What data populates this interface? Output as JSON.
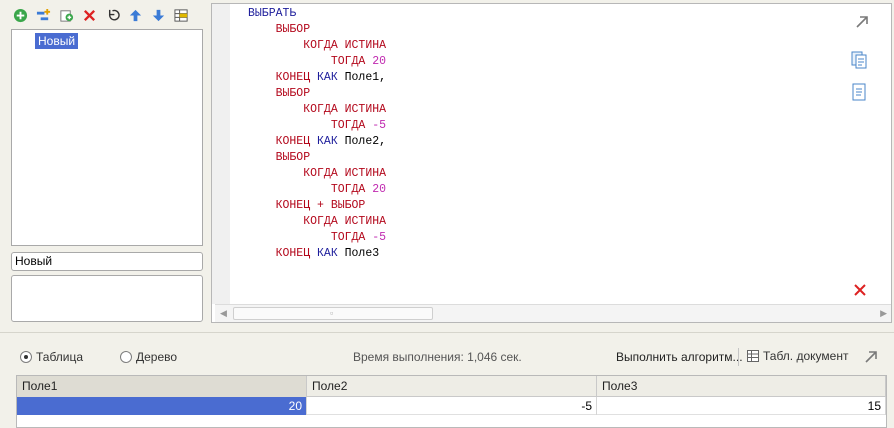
{
  "toolbar": {
    "buttons": [
      {
        "name": "add-icon",
        "color": "#2ea043"
      },
      {
        "name": "add-subquery-icon",
        "color": "#e0a000"
      },
      {
        "name": "copy-icon",
        "color": "#2ea043"
      },
      {
        "name": "delete-icon",
        "color": "#d22"
      },
      {
        "name": "refresh-icon",
        "color": "#333"
      },
      {
        "name": "move-up-icon",
        "color": "#3b7bd6"
      },
      {
        "name": "move-down-icon",
        "color": "#3b7bd6"
      },
      {
        "name": "grid-icon",
        "color": "#555"
      }
    ]
  },
  "queries": {
    "items": [
      "Новый"
    ],
    "name_value": "Новый"
  },
  "editor": {
    "lines": [
      [
        {
          "t": "ВЫБРАТЬ",
          "c": "blue"
        }
      ],
      [
        {
          "t": "    ВЫБОР",
          "c": "kw"
        }
      ],
      [
        {
          "t": "        КОГДА ИСТИНА",
          "c": "kw"
        }
      ],
      [
        {
          "t": "            ТОГДА ",
          "c": "kw"
        },
        {
          "t": "20",
          "c": "num"
        }
      ],
      [
        {
          "t": "    КОНЕЦ ",
          "c": "kw"
        },
        {
          "t": "КАК ",
          "c": "blue"
        },
        {
          "t": "Поле1,",
          "c": "ident"
        }
      ],
      [
        {
          "t": "    ВЫБОР",
          "c": "kw"
        }
      ],
      [
        {
          "t": "        КОГДА ИСТИНА",
          "c": "kw"
        }
      ],
      [
        {
          "t": "            ТОГДА ",
          "c": "kw"
        },
        {
          "t": "-5",
          "c": "num"
        }
      ],
      [
        {
          "t": "    КОНЕЦ ",
          "c": "kw"
        },
        {
          "t": "КАК ",
          "c": "blue"
        },
        {
          "t": "Поле2,",
          "c": "ident"
        }
      ],
      [
        {
          "t": "    ВЫБОР",
          "c": "kw"
        }
      ],
      [
        {
          "t": "        КОГДА ИСТИНА",
          "c": "kw"
        }
      ],
      [
        {
          "t": "            ТОГДА ",
          "c": "kw"
        },
        {
          "t": "20",
          "c": "num"
        }
      ],
      [
        {
          "t": "    КОНЕЦ ",
          "c": "kw"
        },
        {
          "t": "+ ",
          "c": "op"
        },
        {
          "t": "ВЫБОР",
          "c": "kw"
        }
      ],
      [
        {
          "t": "        КОГДА ИСТИНА",
          "c": "kw"
        }
      ],
      [
        {
          "t": "            ТОГДА ",
          "c": "kw"
        },
        {
          "t": "-5",
          "c": "num"
        }
      ],
      [
        {
          "t": "    КОНЕЦ ",
          "c": "kw"
        },
        {
          "t": "КАК ",
          "c": "blue"
        },
        {
          "t": "Поле3",
          "c": "ident"
        }
      ]
    ]
  },
  "results": {
    "view_table_label": "Таблица",
    "view_tree_label": "Дерево",
    "selected_view": "table",
    "exec_time": "Время выполнения: 1,046 сек.",
    "run_label": "Выполнить алгоритм...",
    "doc_label": "Табл. документ",
    "columns": [
      "Поле1",
      "Поле2",
      "Поле3"
    ],
    "rows": [
      [
        "20",
        "-5",
        "15"
      ]
    ]
  }
}
